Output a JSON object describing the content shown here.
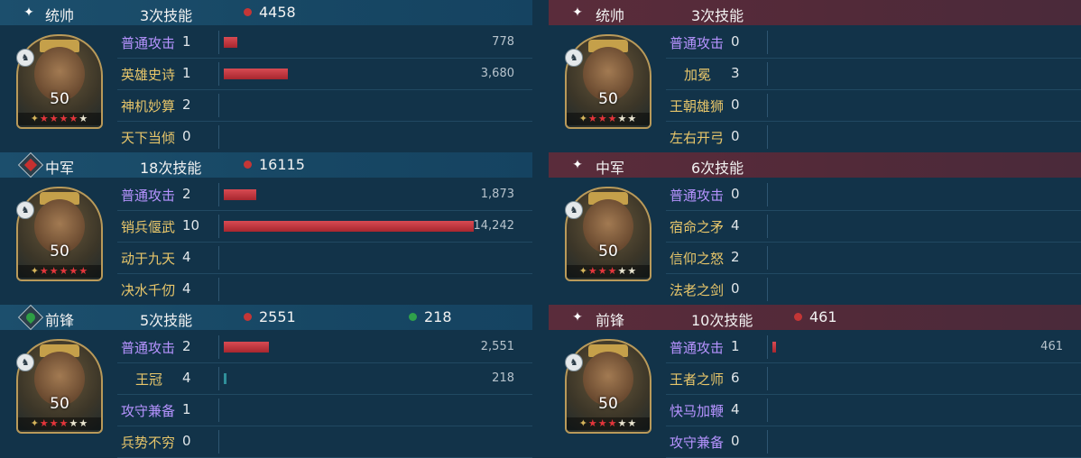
{
  "left": [
    {
      "position": "统帅",
      "position_icon": "sparkle-icon",
      "skill_count": "3次技能",
      "damage": "4458",
      "heal": "",
      "level": "50",
      "stars_on": 4,
      "stars_total": 5,
      "rows": [
        {
          "label": "普通攻击",
          "count": "1",
          "value": "778",
          "bar": 0.045,
          "color": "purple"
        },
        {
          "label": "英雄史诗",
          "count": "1",
          "value": "3,680",
          "bar": 0.215,
          "color": "gold"
        },
        {
          "label": "神机妙算",
          "count": "2",
          "value": "",
          "bar": 0,
          "color": "gold"
        },
        {
          "label": "天下当倾",
          "count": "0",
          "value": "",
          "bar": 0,
          "color": "gold"
        }
      ]
    },
    {
      "position": "中军",
      "position_icon": "red-diamond-icon",
      "skill_count": "18次技能",
      "damage": "16115",
      "heal": "",
      "level": "50",
      "stars_on": 5,
      "stars_total": 5,
      "rows": [
        {
          "label": "普通攻击",
          "count": "2",
          "value": "1,873",
          "bar": 0.11,
          "color": "purple"
        },
        {
          "label": "销兵偃武",
          "count": "10",
          "value": "14,242",
          "bar": 0.84,
          "color": "gold"
        },
        {
          "label": "动于九天",
          "count": "4",
          "value": "",
          "bar": 0,
          "color": "gold"
        },
        {
          "label": "决水千仞",
          "count": "4",
          "value": "",
          "bar": 0,
          "color": "gold"
        }
      ]
    },
    {
      "position": "前锋",
      "position_icon": "green-diamond-icon",
      "skill_count": "5次技能",
      "damage": "2551",
      "heal": "218",
      "level": "50",
      "stars_on": 3,
      "stars_total": 5,
      "rows": [
        {
          "label": "普通攻击",
          "count": "2",
          "value": "2,551",
          "bar": 0.15,
          "color": "purple"
        },
        {
          "label": "王冠",
          "count": "4",
          "value": "218",
          "bar": 0.012,
          "color": "gold",
          "teal": true
        },
        {
          "label": "攻守兼备",
          "count": "1",
          "value": "",
          "bar": 0,
          "color": "purple"
        },
        {
          "label": "兵势不穷",
          "count": "0",
          "value": "",
          "bar": 0,
          "color": "gold"
        }
      ]
    }
  ],
  "right": [
    {
      "position": "统帅",
      "position_icon": "sparkle-icon",
      "skill_count": "3次技能",
      "damage": "",
      "heal": "",
      "level": "50",
      "stars_on": 3,
      "stars_total": 5,
      "rows": [
        {
          "label": "普通攻击",
          "count": "0",
          "value": "",
          "bar": 0,
          "color": "purple"
        },
        {
          "label": "加冕",
          "count": "3",
          "value": "",
          "bar": 0,
          "color": "gold"
        },
        {
          "label": "王朝雄狮",
          "count": "0",
          "value": "",
          "bar": 0,
          "color": "gold"
        },
        {
          "label": "左右开弓",
          "count": "0",
          "value": "",
          "bar": 0,
          "color": "gold"
        }
      ]
    },
    {
      "position": "中军",
      "position_icon": "sparkle-icon",
      "skill_count": "6次技能",
      "damage": "",
      "heal": "",
      "level": "50",
      "stars_on": 3,
      "stars_total": 5,
      "rows": [
        {
          "label": "普通攻击",
          "count": "0",
          "value": "",
          "bar": 0,
          "color": "purple"
        },
        {
          "label": "宿命之矛",
          "count": "4",
          "value": "",
          "bar": 0,
          "color": "gold"
        },
        {
          "label": "信仰之怒",
          "count": "2",
          "value": "",
          "bar": 0,
          "color": "gold"
        },
        {
          "label": "法老之剑",
          "count": "0",
          "value": "",
          "bar": 0,
          "color": "gold"
        }
      ]
    },
    {
      "position": "前锋",
      "position_icon": "sparkle-icon",
      "skill_count": "10次技能",
      "damage": "461",
      "heal": "",
      "level": "50",
      "stars_on": 3,
      "stars_total": 5,
      "rows": [
        {
          "label": "普通攻击",
          "count": "1",
          "value": "461",
          "bar": 0.012,
          "color": "purple"
        },
        {
          "label": "王者之师",
          "count": "6",
          "value": "",
          "bar": 0,
          "color": "gold"
        },
        {
          "label": "快马加鞭",
          "count": "4",
          "value": "",
          "bar": 0,
          "color": "purple"
        },
        {
          "label": "攻守兼备",
          "count": "0",
          "value": "",
          "bar": 0,
          "color": "purple"
        }
      ]
    }
  ]
}
